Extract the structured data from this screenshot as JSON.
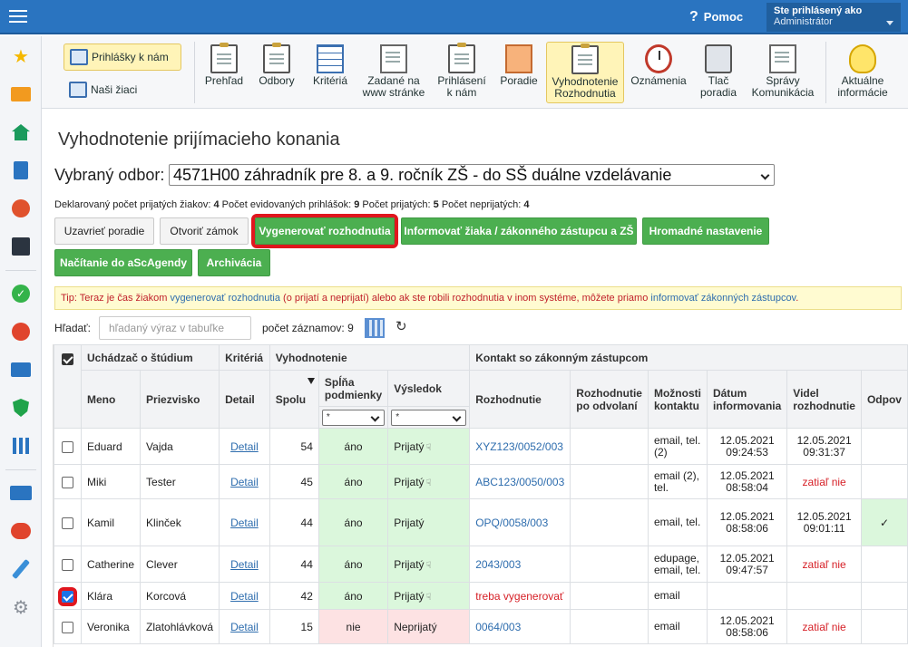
{
  "topbar": {
    "help_label": "Pomoc",
    "user_line1": "Ste prihlásený ako",
    "user_line2": "Administrátor"
  },
  "sidebar_icons": [
    "star-icon",
    "mail-icon",
    "home-icon",
    "book-icon",
    "person-icon",
    "calendar-icon",
    "check-circle-icon",
    "alert-icon",
    "briefcase-icon",
    "shield-icon",
    "chart-icon",
    "open-book-icon",
    "chat-icon",
    "pen-icon",
    "gear-icon"
  ],
  "toolbar": {
    "left": [
      {
        "label": "Prihlášky k nám",
        "active": true
      },
      {
        "label": "Naši žiaci",
        "active": false
      }
    ],
    "items": [
      {
        "label": "Prehľad",
        "icon": "clipboard-eye-icon"
      },
      {
        "label": "Odbory",
        "icon": "clipboard-search-icon"
      },
      {
        "label": "Kritériá",
        "icon": "table-icon"
      },
      {
        "label": "Zadané na www stránke",
        "icon": "page-icon"
      },
      {
        "label": "Prihlásení k nám",
        "icon": "clipboard-check-icon"
      },
      {
        "label": "Poradie",
        "icon": "ranking-icon"
      },
      {
        "label": "Vyhodnotenie Rozhodnutia",
        "icon": "decision-icon",
        "active": true
      },
      {
        "label": "Oznámenia",
        "icon": "clock-icon"
      },
      {
        "label": "Tlač poradia",
        "icon": "printer-icon"
      },
      {
        "label": "Správy Komunikácia",
        "icon": "messages-icon"
      },
      {
        "label": "Aktuálne informácie",
        "icon": "bulb-icon"
      }
    ]
  },
  "main": {
    "title": "Vyhodnotenie prijímacieho konania",
    "odbor_label": "Vybraný odbor:",
    "odbor_value": "4571H00 záhradník pre 8. a 9. ročník ZŠ - do SŠ duálne vzdelávanie",
    "counts": {
      "declared_label": "Deklarovaný počet prijatých žiakov:",
      "declared": "4",
      "registered_label": "Počet evidovaných prihlášok:",
      "registered": "9",
      "accepted_label": "Počet prijatých:",
      "accepted": "5",
      "rejected_label": "Počet neprijatých:",
      "rejected": "4"
    },
    "buttons": {
      "close_ranking": "Uzavrieť poradie",
      "open_lock": "Otvoriť zámok",
      "generate": "Vygenerovať rozhodnutia",
      "inform": "Informovať žiaka / zákonného zástupcu a ZŠ",
      "bulk": "Hromadné nastavenie",
      "load_asc": "Načítanie do aScAgendy",
      "archive": "Archivácia"
    },
    "tip": {
      "t1": "Tip: Teraz je čas žiakom ",
      "l1": "vygenerovať rozhodnutia",
      "t2": " (o prijatí a neprijatí) alebo ak ste robili rozhodnutia v inom systéme, môžete priamo ",
      "l2": "informovať zákonných zástupcov",
      "t3": "."
    },
    "search_label": "Hľadať:",
    "search_placeholder": "hľadaný výraz v tabuľke",
    "records_label": "počet záznamov:",
    "records_count": "9"
  },
  "table": {
    "groups": {
      "applicant": "Uchádzač o štúdium",
      "criteria": "Kritériá",
      "evaluation": "Vyhodnotenie",
      "contact": "Kontakt so zákonným zástupcom"
    },
    "cols": {
      "first": "Meno",
      "last": "Priezvisko",
      "detail": "Detail",
      "total": "Spolu",
      "meets": "Spĺňa podmienky",
      "result": "Výsledok",
      "decision": "Rozhodnutie",
      "appeal": "Rozhodnutie po odvolaní",
      "contact_opts": "Možnosti kontaktu",
      "informed": "Dátum informovania",
      "seen": "Videl rozhodnutie",
      "reply": "Odpov"
    },
    "filter_value": "*",
    "rows": [
      {
        "checked": false,
        "first": "Eduard",
        "last": "Vajda",
        "detail": "Detail",
        "total": "54",
        "meets": "áno",
        "meets_ok": true,
        "result": "Prijatý",
        "thumb": true,
        "decision": "XYZ123/0052/003",
        "decision_warn": false,
        "contact": "email, tel. (2)",
        "informed_d": "12.05.2021",
        "informed_t": "09:24:53",
        "seen_d": "12.05.2021",
        "seen_t": "09:31:37",
        "seen_warn": "",
        "reply": ""
      },
      {
        "checked": false,
        "first": "Miki",
        "last": "Tester",
        "detail": "Detail",
        "total": "45",
        "meets": "áno",
        "meets_ok": true,
        "result": "Prijatý",
        "thumb": true,
        "decision": "ABC123/0050/003",
        "decision_warn": false,
        "contact": "email (2), tel.",
        "informed_d": "12.05.2021",
        "informed_t": "08:58:04",
        "seen_d": "",
        "seen_t": "",
        "seen_warn": "zatiaľ nie",
        "reply": ""
      },
      {
        "checked": false,
        "first": "Kamil",
        "last": "Klinček",
        "detail": "Detail",
        "total": "44",
        "meets": "áno",
        "meets_ok": true,
        "result": "Prijatý",
        "thumb": false,
        "decision": "OPQ/0058/003",
        "decision_warn": false,
        "contact": "email, tel.",
        "informed_d": "12.05.2021",
        "informed_t": "08:58:06",
        "seen_d": "12.05.2021",
        "seen_t": "09:01:11",
        "seen_warn": "",
        "reply": "✓"
      },
      {
        "checked": false,
        "first": "Catherine",
        "last": "Clever",
        "detail": "Detail",
        "total": "44",
        "meets": "áno",
        "meets_ok": true,
        "result": "Prijatý",
        "thumb": true,
        "decision": "2043/003",
        "decision_warn": false,
        "contact": "edupage, email, tel.",
        "informed_d": "12.05.2021",
        "informed_t": "09:47:57",
        "seen_d": "",
        "seen_t": "",
        "seen_warn": "zatiaľ nie",
        "reply": ""
      },
      {
        "checked": true,
        "first": "Klára",
        "last": "Korcová",
        "detail": "Detail",
        "total": "42",
        "meets": "áno",
        "meets_ok": true,
        "result": "Prijatý",
        "thumb": true,
        "decision": "treba vygenerovať",
        "decision_warn": true,
        "contact": "email",
        "informed_d": "",
        "informed_t": "",
        "seen_d": "",
        "seen_t": "",
        "seen_warn": "",
        "reply": ""
      },
      {
        "checked": false,
        "first": "Veronika",
        "last": "Zlatohlávková",
        "detail": "Detail",
        "total": "15",
        "meets": "nie",
        "meets_ok": false,
        "result": "Neprijatý",
        "thumb": false,
        "decision": "0064/003",
        "decision_warn": false,
        "contact": "email",
        "informed_d": "12.05.2021",
        "informed_t": "08:58:06",
        "seen_d": "",
        "seen_t": "",
        "seen_warn": "zatiaľ nie",
        "reply": ""
      }
    ]
  }
}
